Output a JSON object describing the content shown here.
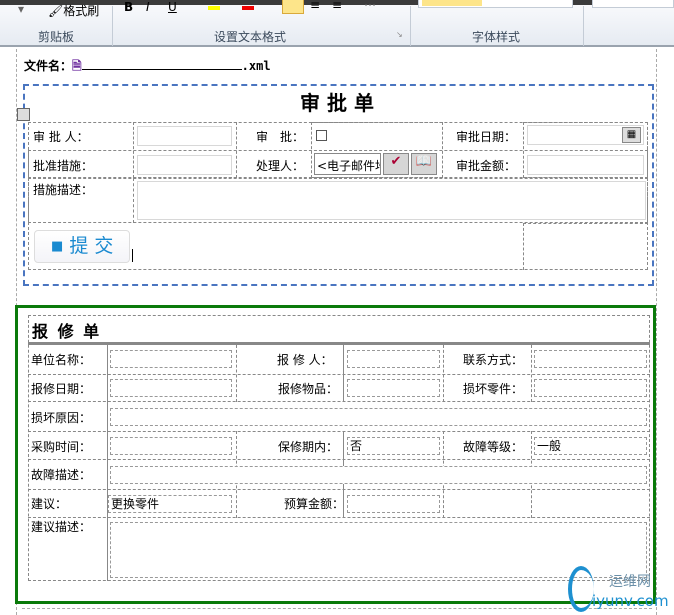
{
  "ribbon": {
    "format_painter": "格式刷",
    "groups": [
      "剪贴板",
      "设置文本格式",
      "字体样式"
    ]
  },
  "file": {
    "label": "文件名：",
    "ext": ".xml"
  },
  "approval": {
    "title": "审 批 单",
    "approver": "审 批 人：",
    "approve": "审　批：",
    "approve_date": "审批日期：",
    "measures": "批准措施：",
    "handler": "处理人：",
    "handler_value": "<电子邮件地址>",
    "amount": "审批金额：",
    "measure_desc": "措施描述：",
    "submit": "提 交"
  },
  "repair": {
    "title": "报 修 单",
    "unit": "单位名称：",
    "reporter": "报 修 人：",
    "contact": "联系方式：",
    "date": "报修日期：",
    "item": "报修物品：",
    "broken_part": "损坏零件：",
    "reason": "损坏原因：",
    "purchase_time": "采购时间：",
    "warranty": "保修期内：",
    "warranty_value": "否",
    "level": "故障等级：",
    "level_value": "一般",
    "fault_desc": "故障描述：",
    "suggest": "建议：",
    "suggest_value": "更换零件",
    "budget": "预算金额：",
    "suggest_desc": "建议描述："
  },
  "watermark": {
    "cn": "运维网",
    "en": "iyunv.com"
  }
}
